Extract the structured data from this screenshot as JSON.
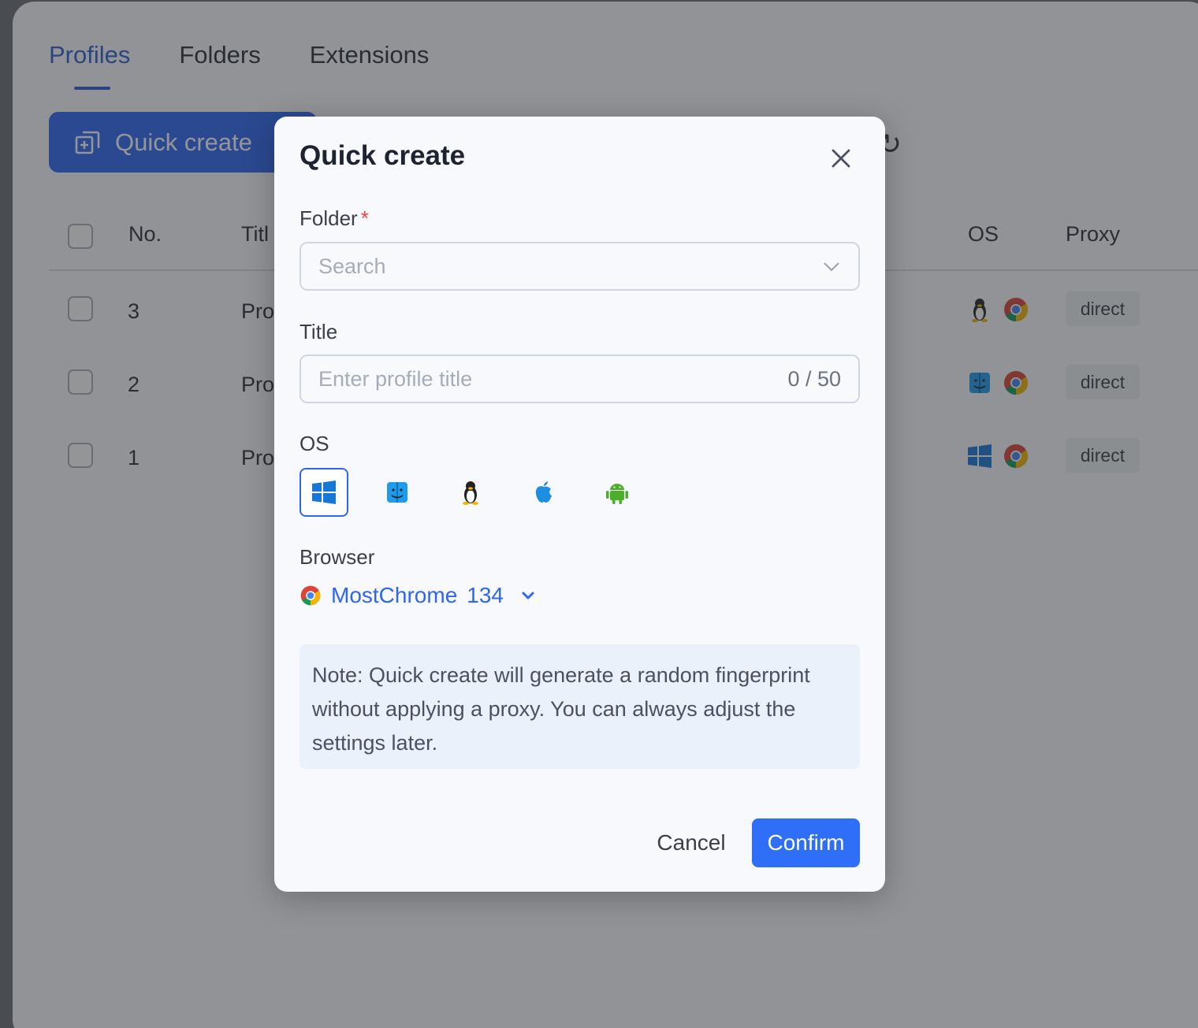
{
  "tabs": [
    {
      "label": "Profiles",
      "active": true
    },
    {
      "label": "Folders",
      "active": false
    },
    {
      "label": "Extensions",
      "active": false
    }
  ],
  "toolbar": {
    "quick_create_label": "Quick create"
  },
  "table": {
    "headers": {
      "no": "No.",
      "title": "Titl",
      "os": "OS",
      "proxy": "Proxy"
    },
    "rows": [
      {
        "no": "3",
        "title": "Pro",
        "os": "linux",
        "browser": "chrome",
        "proxy": "direct"
      },
      {
        "no": "2",
        "title": "Pro",
        "os": "macos",
        "browser": "chrome",
        "proxy": "direct"
      },
      {
        "no": "1",
        "title": "Pro",
        "os": "windows",
        "browser": "chrome",
        "proxy": "direct"
      }
    ]
  },
  "modal": {
    "title": "Quick create",
    "folder": {
      "label": "Folder",
      "required_mark": "*",
      "placeholder": "Search",
      "value": ""
    },
    "title_field": {
      "label": "Title",
      "placeholder": "Enter profile title",
      "value": "",
      "counter": "0 / 50"
    },
    "os": {
      "label": "OS",
      "options": [
        "windows-icon",
        "macos-icon",
        "linux-icon",
        "ios-icon",
        "android-icon"
      ],
      "selected": "windows"
    },
    "browser": {
      "label": "Browser",
      "name": "MostChrome",
      "version": "134"
    },
    "note": "Note: Quick create will generate a random fingerprint without applying a proxy. You can always adjust the settings later.",
    "cancel_label": "Cancel",
    "confirm_label": "Confirm"
  },
  "colors": {
    "accent": "#2f66f0",
    "required": "#e5484d",
    "note_bg": "#ebf1fb"
  }
}
